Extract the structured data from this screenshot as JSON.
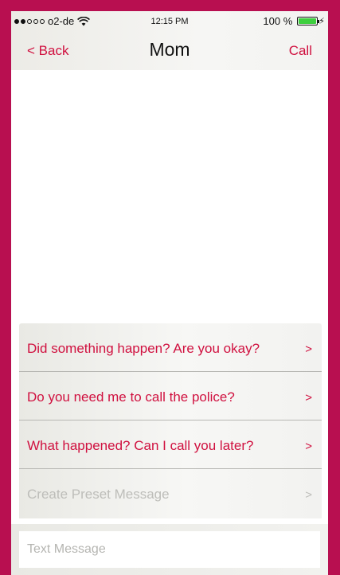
{
  "status_bar": {
    "carrier": "o2-de",
    "time": "12:15 PM",
    "battery": "100 %",
    "battery_level": 1.0,
    "signal_bars": 2,
    "signal_total": 5
  },
  "nav": {
    "back_label": "< Back",
    "title": "Mom",
    "call_label": "Call"
  },
  "preset_messages": [
    {
      "label": "Did something happen? Are you okay?",
      "chevron": ">"
    },
    {
      "label": "Do you need me to call the police?",
      "chevron": ">"
    },
    {
      "label": "What happened? Can I call you later?",
      "chevron": ">"
    },
    {
      "label": "Create Preset Message",
      "chevron": ">"
    }
  ],
  "composer": {
    "placeholder": "Text Message",
    "value": ""
  },
  "colors": {
    "accent": "#d0103f",
    "frame": "#b80f50",
    "muted": "#bdbdb9"
  }
}
